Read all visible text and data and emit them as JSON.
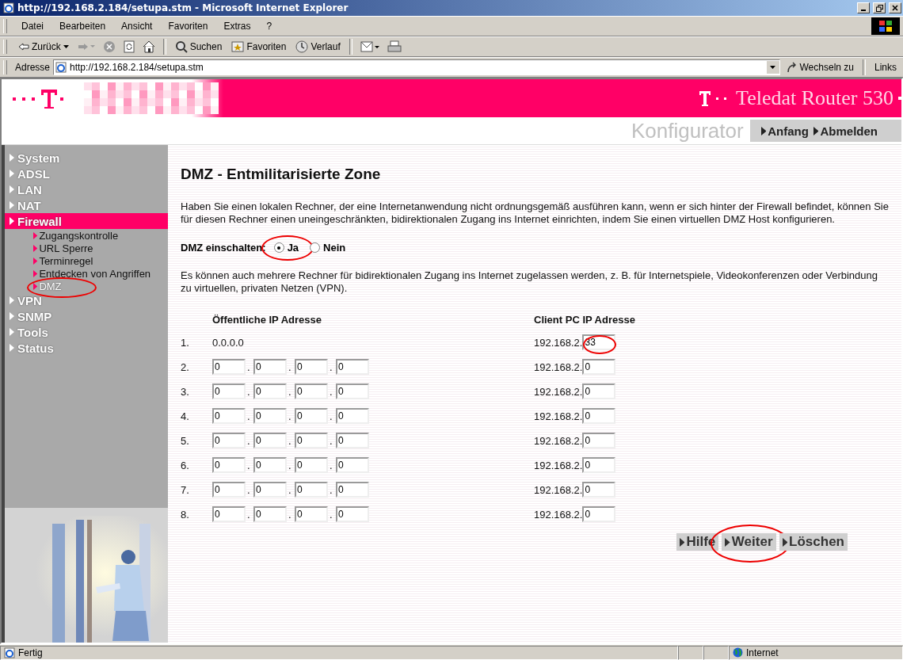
{
  "window": {
    "title": "http://192.168.2.184/setupa.stm - Microsoft Internet Explorer"
  },
  "menu": [
    "Datei",
    "Bearbeiten",
    "Ansicht",
    "Favoriten",
    "Extras",
    "?"
  ],
  "toolbar": {
    "back": "Zurück",
    "search": "Suchen",
    "favorites": "Favoriten",
    "history": "Verlauf"
  },
  "address_bar": {
    "label": "Adresse",
    "url": "http://192.168.2.184/setupa.stm",
    "go": "Wechseln zu",
    "links": "Links"
  },
  "header": {
    "brand": "Teledat Router 530",
    "subtitle": "Konfigurator",
    "nav": [
      "Anfang",
      "Abmelden"
    ]
  },
  "sidebar": {
    "items": [
      {
        "label": "System",
        "selected": false
      },
      {
        "label": "ADSL",
        "selected": false
      },
      {
        "label": "LAN",
        "selected": false
      },
      {
        "label": "NAT",
        "selected": false
      },
      {
        "label": "Firewall",
        "selected": true,
        "children": [
          {
            "label": "Zugangskontrolle",
            "selected": false,
            "annotated": false
          },
          {
            "label": "URL Sperre",
            "selected": false,
            "annotated": false
          },
          {
            "label": "Terminregel",
            "selected": false,
            "annotated": false
          },
          {
            "label": "Entdecken von Angriffen",
            "selected": false,
            "annotated": false
          },
          {
            "label": "DMZ",
            "selected": true,
            "annotated": true
          }
        ]
      },
      {
        "label": "VPN",
        "selected": false
      },
      {
        "label": "SNMP",
        "selected": false
      },
      {
        "label": "Tools",
        "selected": false
      },
      {
        "label": "Status",
        "selected": false
      }
    ]
  },
  "main": {
    "title": "DMZ - Entmilitarisierte Zone",
    "intro": "Haben Sie einen lokalen Rechner, der eine Internetanwendung nicht ordnungsgemäß ausführen kann, wenn er sich hinter der Firewall befindet, können Sie für diesen Rechner einen uneingeschränkten, bidirektionalen Zugang ins Internet einrichten, indem Sie einen virtuellen DMZ Host konfigurieren.",
    "dmz_switch": {
      "label": "DMZ einschalten:",
      "options": [
        {
          "label": "Ja",
          "selected": true,
          "annotated": true
        },
        {
          "label": "Nein",
          "selected": false,
          "annotated": false
        }
      ]
    },
    "note": "Es können auch mehrere Rechner für bidirektionalen Zugang ins Internet zugelassen werden, z. B. für Internetspiele, Videokonferenzen oder Verbindung zu virtuellen, privaten Netzen (VPN).",
    "table": {
      "columns": [
        "Öffentliche IP Adresse",
        "Client PC IP Adresse"
      ],
      "separator": ".",
      "rows": [
        {
          "number": "1.",
          "public": "0.0.0.0",
          "client_prefix": "192.168.2.",
          "client": "33",
          "annotated": true
        },
        {
          "number": "2.",
          "public_fields": [
            "0",
            "0",
            "0",
            "0"
          ],
          "client_prefix": "192.168.2.",
          "client": "0",
          "annotated": false
        },
        {
          "number": "3.",
          "public_fields": [
            "0",
            "0",
            "0",
            "0"
          ],
          "client_prefix": "192.168.2.",
          "client": "0",
          "annotated": false
        },
        {
          "number": "4.",
          "public_fields": [
            "0",
            "0",
            "0",
            "0"
          ],
          "client_prefix": "192.168.2.",
          "client": "0",
          "annotated": false
        },
        {
          "number": "5.",
          "public_fields": [
            "0",
            "0",
            "0",
            "0"
          ],
          "client_prefix": "192.168.2.",
          "client": "0",
          "annotated": false
        },
        {
          "number": "6.",
          "public_fields": [
            "0",
            "0",
            "0",
            "0"
          ],
          "client_prefix": "192.168.2.",
          "client": "0",
          "annotated": false
        },
        {
          "number": "7.",
          "public_fields": [
            "0",
            "0",
            "0",
            "0"
          ],
          "client_prefix": "192.168.2.",
          "client": "0",
          "annotated": false
        },
        {
          "number": "8.",
          "public_fields": [
            "0",
            "0",
            "0",
            "0"
          ],
          "client_prefix": "192.168.2.",
          "client": "0",
          "annotated": false
        }
      ]
    },
    "buttons": [
      {
        "label": "Hilfe",
        "annotated": false
      },
      {
        "label": "Weiter",
        "annotated": true
      },
      {
        "label": "Löschen",
        "annotated": false
      }
    ]
  },
  "status_bar": {
    "text": "Fertig",
    "zone": "Internet"
  }
}
